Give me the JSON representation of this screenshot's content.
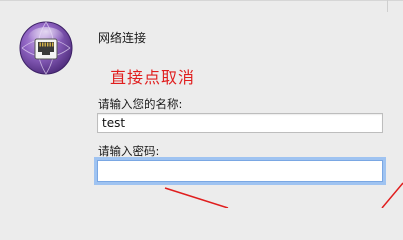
{
  "dialog": {
    "title": "网络连接",
    "annotation": "直接点取消",
    "username_label": "请输入您的名称:",
    "username_value": "test",
    "password_label": "请输入密码:",
    "password_value": ""
  },
  "icons": {
    "network": "network-ethernet-icon"
  },
  "colors": {
    "annotation": "#e01e1e",
    "focus_ring": "#9fc3f1",
    "icon_purple": "#7a4fa8"
  }
}
